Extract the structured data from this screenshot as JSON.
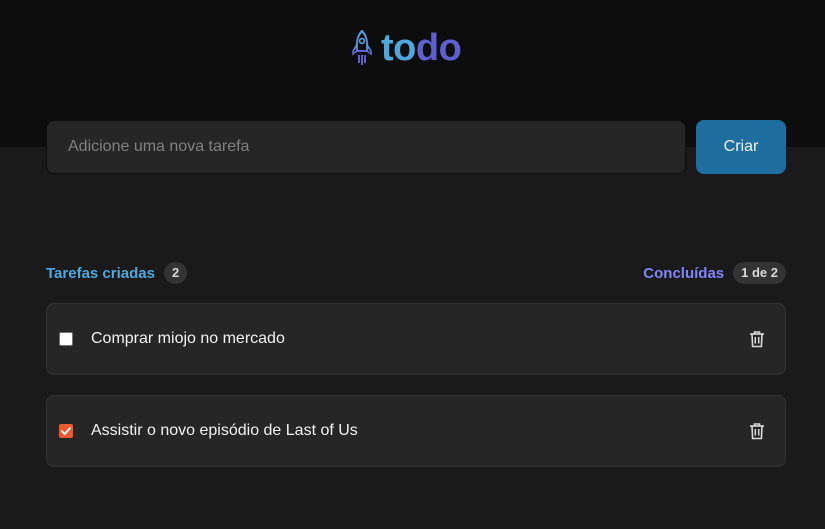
{
  "logo": {
    "part1": "to",
    "part2": "do",
    "icon": "rocket-icon"
  },
  "new_task": {
    "placeholder": "Adicione uma nova tarefa",
    "value": "",
    "create_label": "Criar"
  },
  "counters": {
    "created_label": "Tarefas criadas",
    "created_count": "2",
    "done_label": "Concluídas",
    "done_count": "1 de 2"
  },
  "tasks": [
    {
      "text": "Comprar miojo no mercado",
      "done": false
    },
    {
      "text": "Assistir o novo episódio de Last of Us",
      "done": true
    }
  ],
  "colors": {
    "header_bg": "#0d0d0d",
    "page_bg": "#1a1a1a",
    "blue": "#4ea8de",
    "purple": "#5e60ce",
    "purple_light": "#8284fa",
    "button": "#1e6f9f",
    "check_done": "#ee5a2e"
  }
}
